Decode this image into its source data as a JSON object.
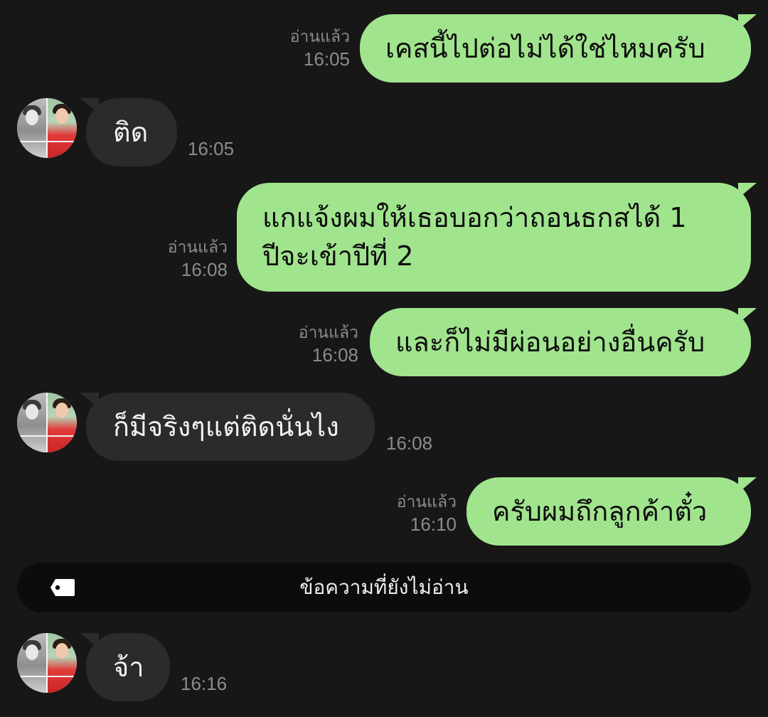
{
  "messages": [
    {
      "id": 1,
      "direction": "outgoing",
      "text": "เคสนี้ไปต่อไม่ได้ใช่ไหมครับ",
      "read_label": "อ่านแล้ว",
      "time": "16:05"
    },
    {
      "id": 2,
      "direction": "incoming",
      "text": "ติด",
      "time": "16:05"
    },
    {
      "id": 3,
      "direction": "outgoing",
      "lines": [
        "แกแจ้งผมให้เธอบอกว่าถอนธกสได้ 1",
        "ปีจะเข้าปีที่ 2"
      ],
      "read_label": "อ่านแล้ว",
      "time": "16:08"
    },
    {
      "id": 4,
      "direction": "outgoing",
      "text": "และก็ไม่มีผ่อนอย่างอื่นครับ",
      "read_label": "อ่านแล้ว",
      "time": "16:08"
    },
    {
      "id": 5,
      "direction": "incoming",
      "text": "ก็มีจริงๆแต่ติดนั่นไง",
      "time": "16:08"
    },
    {
      "id": 6,
      "direction": "outgoing",
      "text": "ครับผมถึกลูกค้าตั๋ว",
      "read_label": "อ่านแล้ว",
      "time": "16:10"
    },
    {
      "id": 7,
      "direction": "incoming",
      "text": "จ้า",
      "time": "16:16"
    }
  ],
  "unread_banner": {
    "label": "ข้อความที่ยังไม่อ่าน",
    "icon": "tag-icon"
  },
  "colors": {
    "background": "#171717",
    "outgoing_bubble": "#a1e48e",
    "incoming_bubble": "#2b2b2b",
    "meta_text": "#8c8c8c",
    "banner": "#0c0c0c"
  }
}
